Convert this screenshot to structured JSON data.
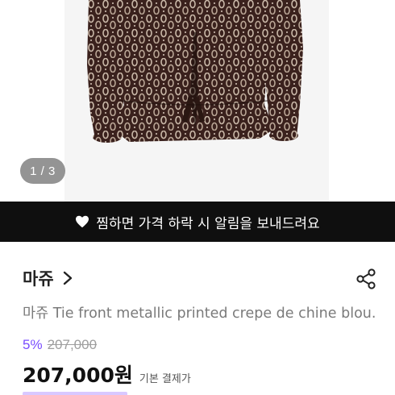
{
  "gallery": {
    "counter": "1 / 3"
  },
  "wishlist_banner": {
    "icon": "heart-icon",
    "text": "찜하면 가격 하락 시 알림을 보내드려요"
  },
  "seller": {
    "name": "마쥬"
  },
  "product": {
    "title": "마쥬 Tie front metallic printed crepe de chine blou..."
  },
  "pricing": {
    "discount_rate": "5%",
    "original_price": "207,000",
    "price": "207,000원",
    "price_caption": "기본 결제가"
  },
  "colors": {
    "accent": "#7a4dff",
    "banner_bg": "#0f0f0f",
    "print_dark": "#3a211d",
    "print_light": "#c9b8a8"
  }
}
